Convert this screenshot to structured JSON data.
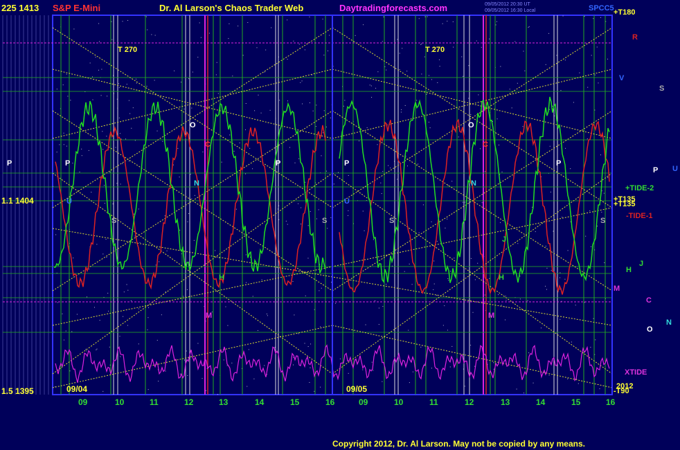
{
  "header": {
    "left_price_label": "225 1413",
    "instrument": "S&P E-Mini",
    "site_name": "Dr. Al Larson's Chaos Trader Web",
    "site_url": "Daytradingforecasts.com",
    "timestamp_1": "09/05/2012 20:30 UT",
    "timestamp_2": "09/05/2012 16:30 Local",
    "right_code": "SPCC5"
  },
  "copyright": "Copyright 2012, Dr. Al Larson. May not be copied by any means.",
  "colors": {
    "background": "#00005a",
    "price_line": "#dd2222",
    "tide_line": "#22dd22",
    "xtide_line": "#dd22dd",
    "gann_lines": "#dddd33",
    "grid_green": "#22aa22",
    "grid_white": "#dddddd"
  },
  "chart_data": {
    "type": "line",
    "days": [
      "09/04",
      "09/05"
    ],
    "x_ticks": [
      "09",
      "10",
      "11",
      "12",
      "13",
      "14",
      "15",
      "16"
    ],
    "y_labels_left": [
      "225 1413",
      "1.1 1404",
      "1.5 1395"
    ],
    "bottom_right_label": "2012",
    "markers": {
      "turn_labels": [
        "T 270",
        "T 270"
      ],
      "planet_letters": [
        "P",
        "O",
        "N",
        "S",
        "M",
        "U",
        "H",
        "J",
        "C",
        "R"
      ]
    },
    "right_labels": {
      "top": "+T180",
      "tide2": "+TIDE-2",
      "tide1": "-TIDE-1",
      "t135_a": "+T135",
      "t135_b": "+T135",
      "xtide": "XTIDE",
      "bottom": "-T90",
      "R": "R",
      "V": "V",
      "S": "S",
      "P": "P",
      "U": "U",
      "J": "J",
      "H": "H",
      "M": "M",
      "C": "C",
      "O": "O",
      "N": "N"
    }
  }
}
